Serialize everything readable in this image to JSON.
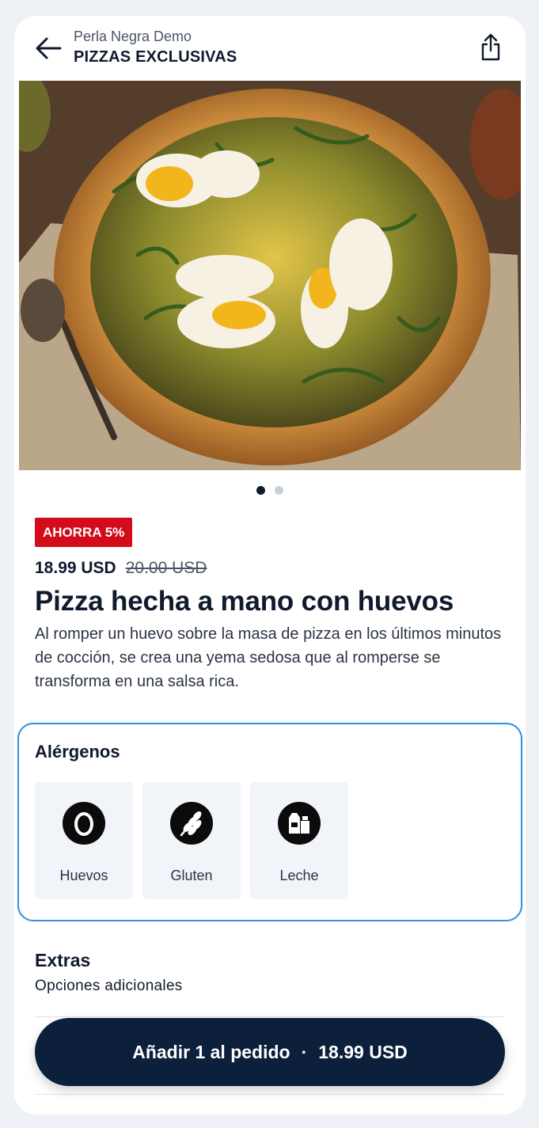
{
  "header": {
    "store_name": "Perla Negra Demo",
    "category": "PIZZAS EXCLUSIVAS",
    "back_icon": "arrow-left-icon",
    "share_icon": "share-icon"
  },
  "gallery": {
    "image_alt": "Pizza con huevos pochados, rúcula y pesto",
    "pages_total": 2,
    "active_page": 1
  },
  "product": {
    "badge": "AHORRA 5%",
    "price": "18.99 USD",
    "old_price": "20.00 USD",
    "name": "Pizza hecha a mano con huevos",
    "description": "Al romper un huevo sobre la masa de pizza en los últimos minutos de cocción, se crea una yema sedosa que al romperse se transforma en una salsa rica."
  },
  "allergens": {
    "title": "Alérgenos",
    "items": [
      {
        "label": "Huevos",
        "icon": "egg-icon"
      },
      {
        "label": "Gluten",
        "icon": "wheat-icon"
      },
      {
        "label": "Leche",
        "icon": "milk-icon"
      }
    ]
  },
  "extras": {
    "title": "Extras",
    "subtitle": "Opciones adicionales"
  },
  "cta": {
    "label": "Añadir 1 al pedido",
    "separator": "·",
    "price": "18.99 USD"
  },
  "colors": {
    "badge_bg": "#d30b1b",
    "cta_bg": "#0c1f3b",
    "allergen_border": "#2f8fe0"
  }
}
